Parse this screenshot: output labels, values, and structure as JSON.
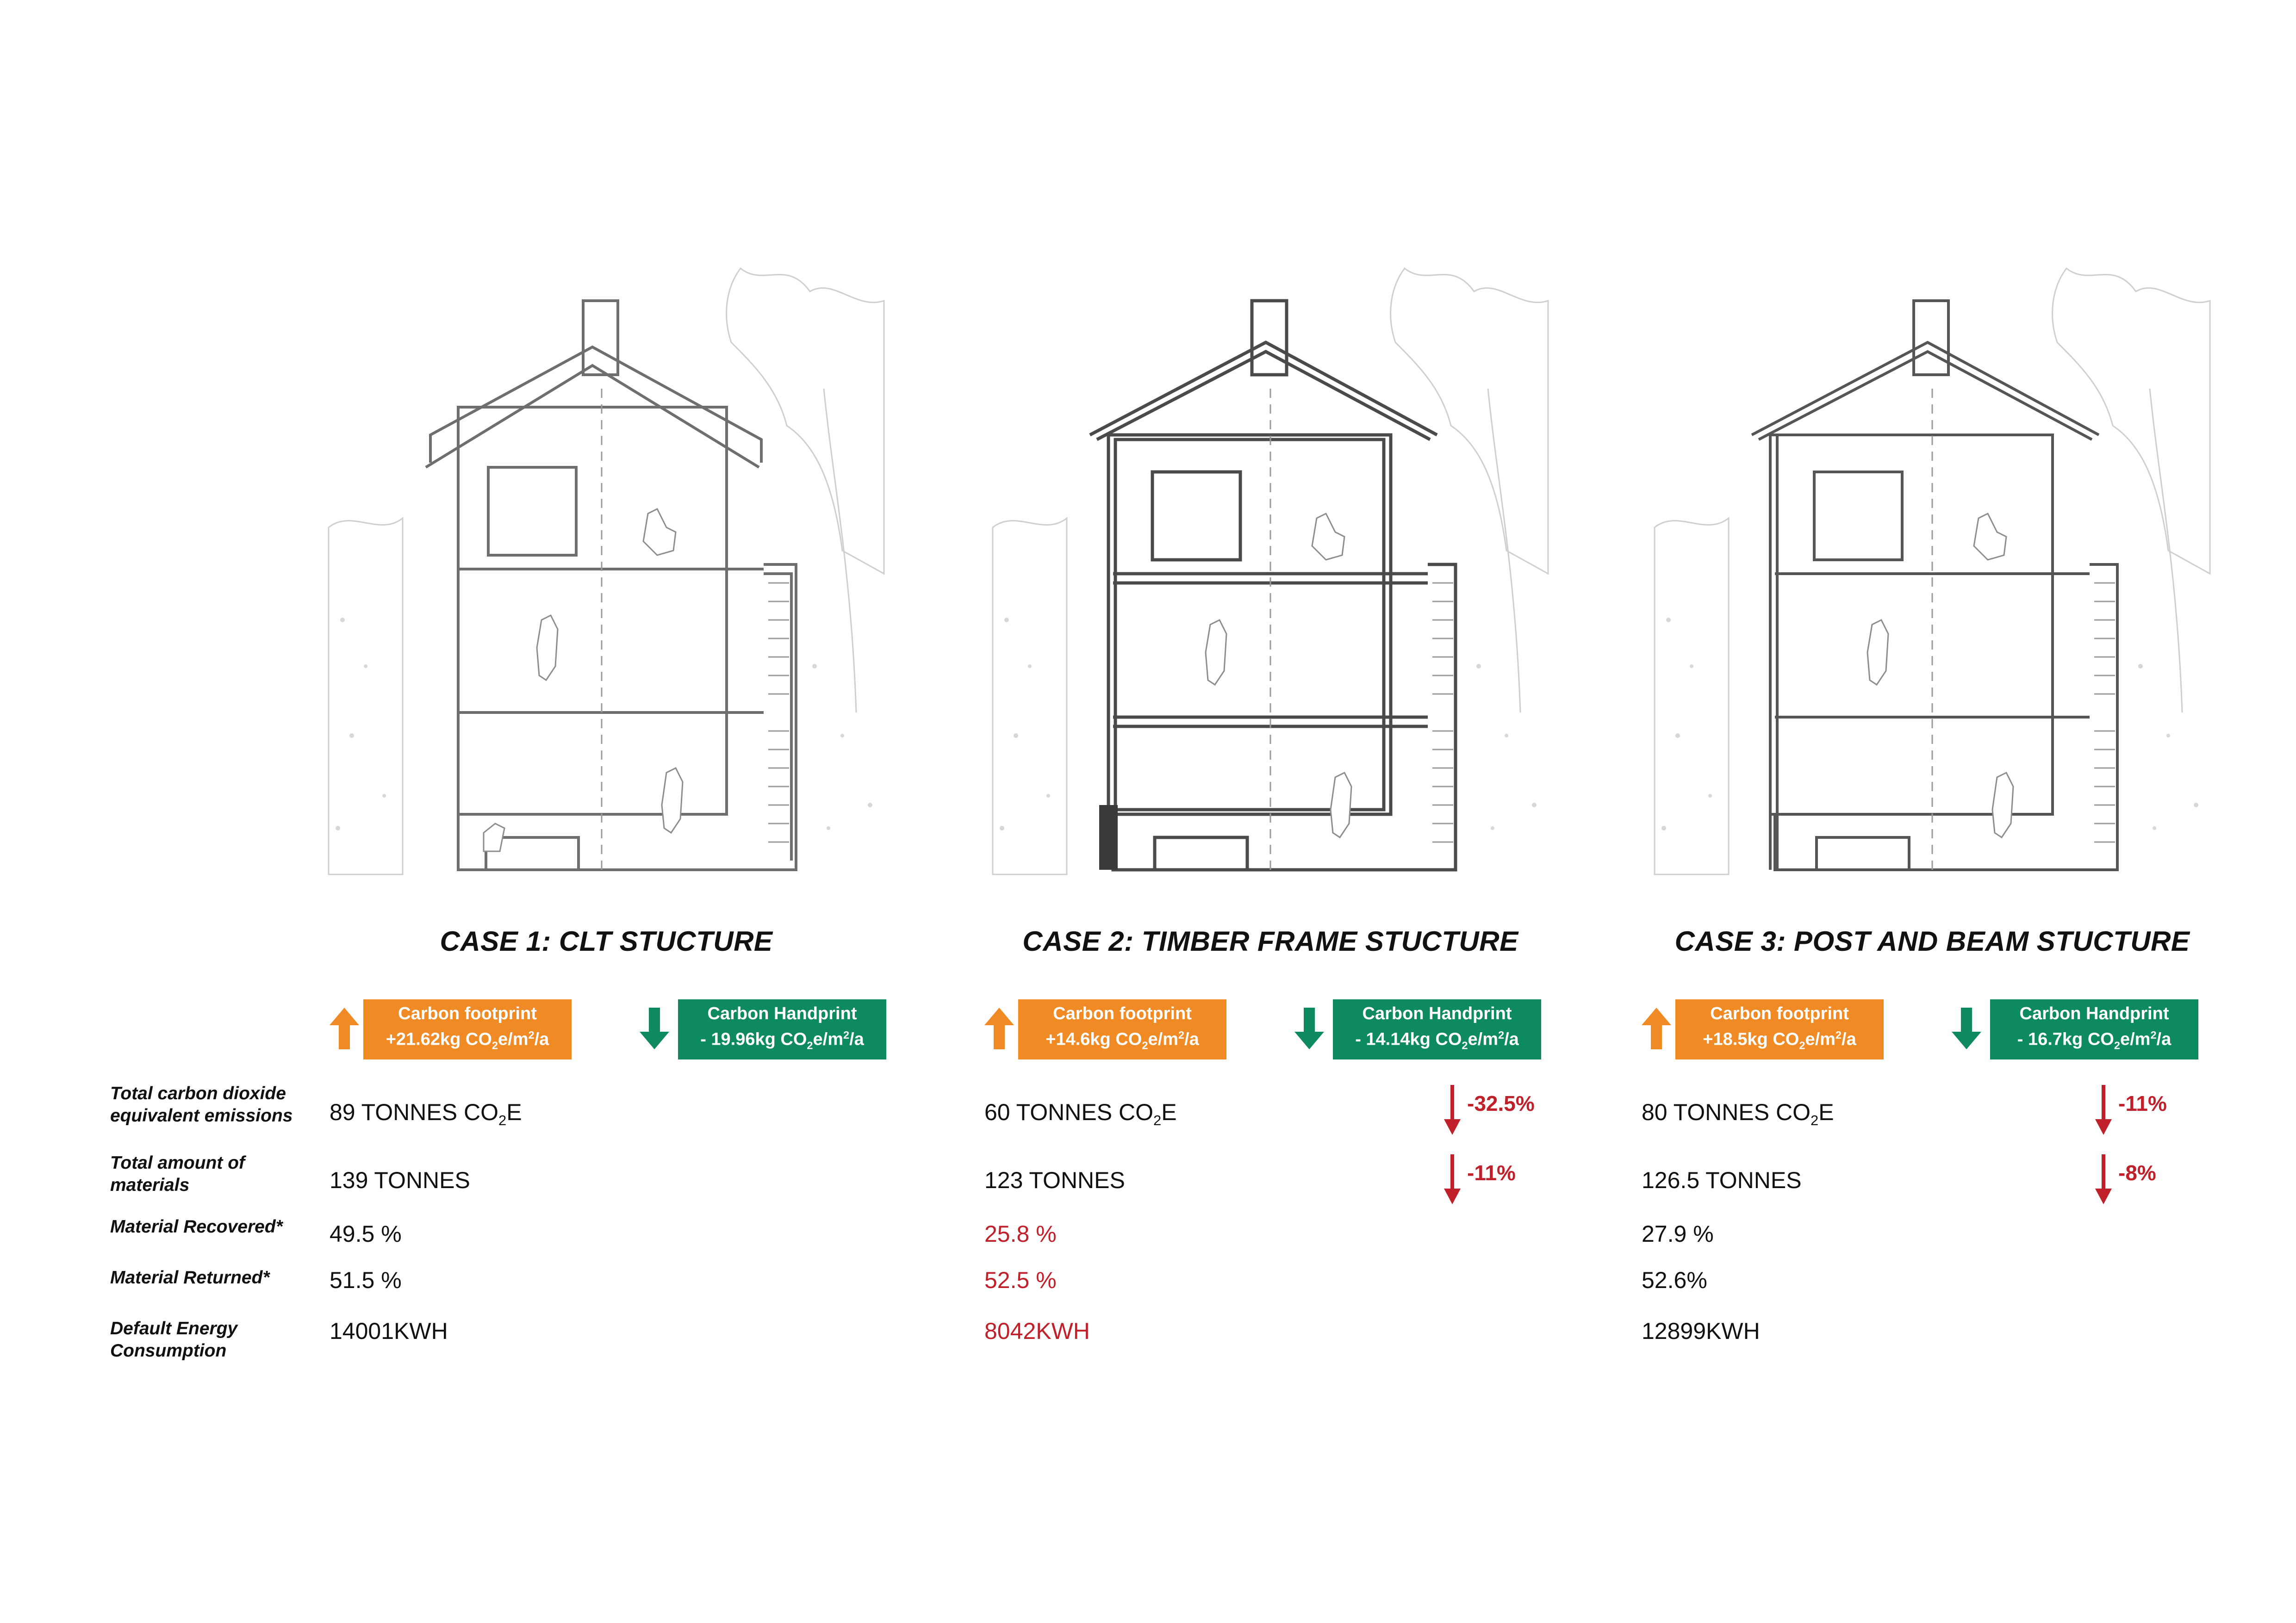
{
  "colors": {
    "footprint": "#F08A24",
    "handprint": "#0E8A5F",
    "highlight_red": "#C0202A"
  },
  "row_labels": [
    "Total carbon dioxide equivalent emissions",
    "Total amount of materials",
    "Material Recovered*",
    "Material Returned*",
    "Default Energy Consumption"
  ],
  "cases": [
    {
      "title": "CASE 1: CLT STUCTURE",
      "footprint": {
        "label": "Carbon footprint",
        "value": "+21.62kg",
        "icon": "arrow-up-icon"
      },
      "handprint": {
        "label": "Carbon Handprint",
        "value": "- 19.96kg",
        "icon": "arrow-down-icon"
      },
      "emissions": "89 TONNES",
      "materials": "139 TONNES",
      "recovered": "49.5 %",
      "returned": "51.5 %",
      "energy": "14001KWH"
    },
    {
      "title": "CASE 2: TIMBER FRAME STUCTURE",
      "footprint": {
        "label": "Carbon footprint",
        "value": "+14.6kg",
        "icon": "arrow-up-icon"
      },
      "handprint": {
        "label": "Carbon Handprint",
        "value": "- 14.14kg",
        "icon": "arrow-down-icon"
      },
      "emissions": "60 TONNES",
      "emissions_delta": "-32.5%",
      "materials": "123 TONNES",
      "materials_delta": "-11%",
      "recovered": "25.8 %",
      "returned": "52.5 %",
      "energy": "8042KWH"
    },
    {
      "title": "CASE 3: POST AND BEAM STUCTURE",
      "footprint": {
        "label": "Carbon footprint",
        "value": "+18.5kg",
        "icon": "arrow-up-icon"
      },
      "handprint": {
        "label": "Carbon Handprint",
        "value": "- 16.7kg",
        "icon": "arrow-down-icon"
      },
      "emissions": "80 TONNES",
      "emissions_delta": "-11%",
      "materials": "126.5 TONNES",
      "materials_delta": "-8%",
      "recovered": "27.9 %",
      "returned": "52.6%",
      "energy": "12899KWH"
    }
  ],
  "units": {
    "co2e_prefix": "CO",
    "co2e_sub": "2",
    "co2e_suffix": "E",
    "rate_prefix": " CO",
    "rate_sub": "2",
    "rate_mid": "e/m",
    "rate_sup": "2",
    "rate_suffix": "/a"
  }
}
